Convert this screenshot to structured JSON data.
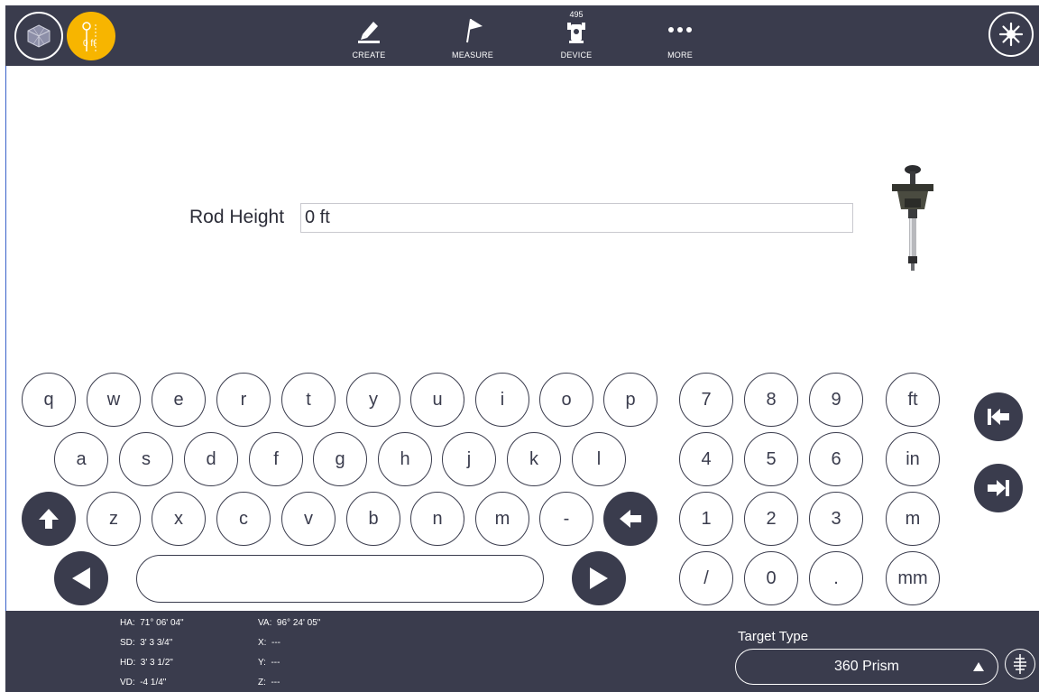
{
  "topbar": {
    "height_indicator": "0 ft",
    "nav": [
      {
        "label": "CREATE",
        "icon": "pencil-icon"
      },
      {
        "label": "MEASURE",
        "icon": "flag-icon"
      },
      {
        "label": "DEVICE",
        "icon": "total-station-icon",
        "badge": "495"
      },
      {
        "label": "MORE",
        "icon": "more-dots-icon"
      }
    ]
  },
  "rod": {
    "label": "Rod Height",
    "value": "0 ft"
  },
  "keyboard": {
    "row1": [
      "q",
      "w",
      "e",
      "r",
      "t",
      "y",
      "u",
      "i",
      "o",
      "p"
    ],
    "row2": [
      "a",
      "s",
      "d",
      "f",
      "g",
      "h",
      "j",
      "k",
      "l"
    ],
    "row3": [
      "z",
      "x",
      "c",
      "v",
      "b",
      "n",
      "m",
      "-"
    ],
    "numpad": [
      [
        "7",
        "8",
        "9",
        "ft"
      ],
      [
        "4",
        "5",
        "6",
        "in"
      ],
      [
        "1",
        "2",
        "3",
        "m"
      ],
      [
        "/",
        "0",
        ".",
        "mm"
      ]
    ]
  },
  "status": {
    "ha": "HA:  71° 06' 04\"",
    "sd": "SD:  3' 3 3/4\"",
    "hd": "HD:  3' 3 1/2\"",
    "vd": "VD:  -4 1/4\"",
    "va": "VA:  96° 24' 05\"",
    "x": "X:  ---",
    "y": "Y:  ---",
    "z": "Z:  ---"
  },
  "target": {
    "label": "Target Type",
    "value": "360 Prism"
  },
  "colors": {
    "bar": "#3a3c4d",
    "accent": "#f7b500",
    "border_line": "#3a62c9"
  }
}
